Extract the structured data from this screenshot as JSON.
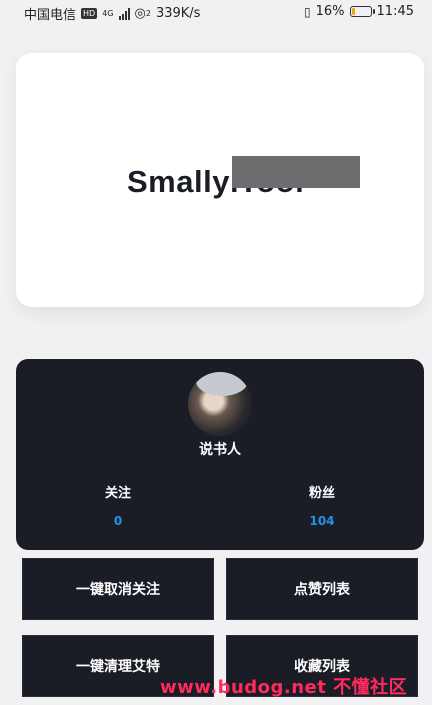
{
  "status_bar": {
    "carrier": "中国电信",
    "hd_badge": "HD",
    "network": "4G",
    "signal_sub": "2",
    "speed": "339K/s",
    "battery_percent_text": "16%",
    "battery_level": 0.16,
    "time": "11:45"
  },
  "app": {
    "title": "SmallyiTool"
  },
  "profile": {
    "username": "说书人",
    "following_label": "关注",
    "following_count": "0",
    "followers_label": "粉丝",
    "followers_count": "104"
  },
  "actions": {
    "unfollow_all": "一键取消关注",
    "like_list": "点赞列表",
    "clean_mentions": "一键清理艾特",
    "favorites_list": "收藏列表"
  },
  "watermark": "www.budog.net 不懂社区",
  "colors": {
    "background": "#f1f1f3",
    "card_dark": "#1b1d26",
    "count_accent": "#1e94ef",
    "watermark": "#ff2a5e",
    "battery": "#f0a21b"
  }
}
